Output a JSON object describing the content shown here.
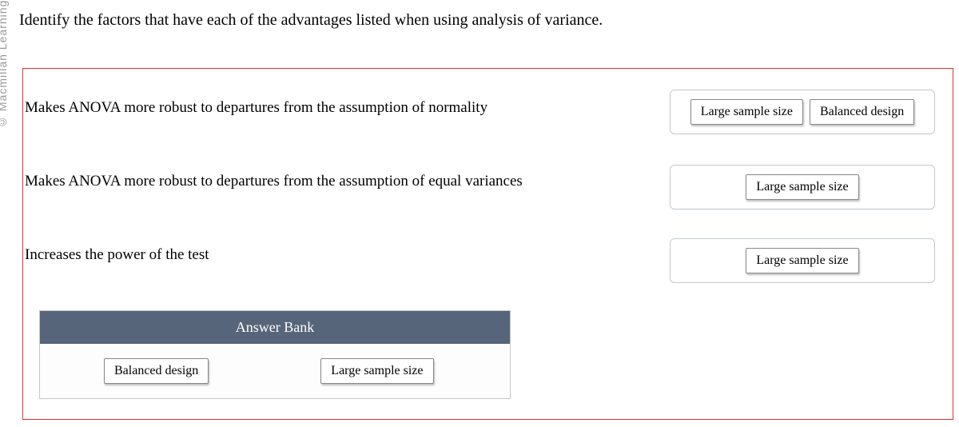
{
  "copyright": "© Macmillan Learning",
  "question": "Identify the factors that have each of the advantages listed when using analysis of variance.",
  "rows": [
    {
      "prompt": "Makes ANOVA more robust to departures from the assumption of normality",
      "answers": [
        "Large sample size",
        "Balanced design"
      ]
    },
    {
      "prompt": "Makes ANOVA more robust to departures from the assumption of equal variances",
      "answers": [
        "Large sample size"
      ]
    },
    {
      "prompt": "Increases the power of the test",
      "answers": [
        "Large sample size"
      ]
    }
  ],
  "answerBank": {
    "title": "Answer Bank",
    "options": [
      "Balanced design",
      "Large sample size"
    ]
  }
}
